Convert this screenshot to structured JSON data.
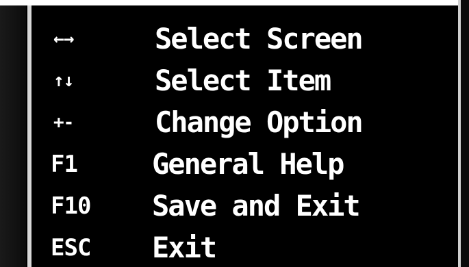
{
  "bios_help": {
    "items": [
      {
        "key": "←→",
        "description": "Select Screen"
      },
      {
        "key": "↑↓",
        "description": "Select Item"
      },
      {
        "key": "+-",
        "description": "Change Option"
      },
      {
        "key": "F1",
        "description": "General Help"
      },
      {
        "key": "F10",
        "description": "Save and Exit"
      },
      {
        "key": "ESC",
        "description": "Exit"
      }
    ]
  },
  "colors": {
    "background": "#000000",
    "text": "#ffffff",
    "border": "#d8d8d8"
  }
}
